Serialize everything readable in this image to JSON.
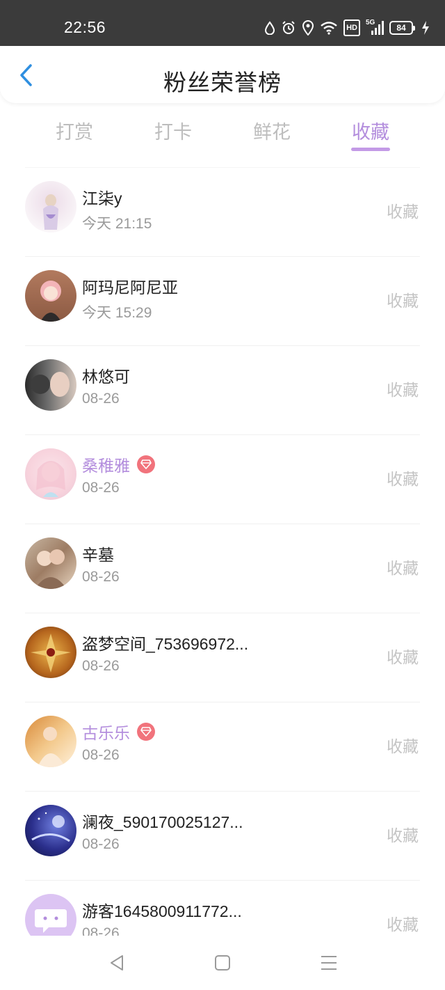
{
  "status_bar": {
    "time": "22:56",
    "network": "5G",
    "hd": "HD",
    "battery": "84",
    "icons": [
      "drop-icon",
      "alarm-icon",
      "location-icon",
      "wifi-icon",
      "hd-icon",
      "signal-icon",
      "battery-icon",
      "charging-icon"
    ]
  },
  "header": {
    "title": "粉丝荣誉榜",
    "back_icon": "chevron-left-icon"
  },
  "tabs": [
    {
      "label": "打赏",
      "active": false
    },
    {
      "label": "打卡",
      "active": false
    },
    {
      "label": "鲜花",
      "active": false
    },
    {
      "label": "收藏",
      "active": true
    }
  ],
  "colors": {
    "accent": "#b38ddd",
    "vip_badge": "#f1737c",
    "status_bar": "#3b3b3b",
    "muted_text": "#9a9a9a",
    "action_text": "#c4c4c4"
  },
  "fans": [
    {
      "name": "江柒y",
      "time": "今天 21:15",
      "action": "收藏",
      "vip": false
    },
    {
      "name": "阿玛尼阿尼亚",
      "time": "今天 15:29",
      "action": "收藏",
      "vip": false
    },
    {
      "name": "林悠可",
      "time": "08-26",
      "action": "收藏",
      "vip": false
    },
    {
      "name": "桑稚雅",
      "time": "08-26",
      "action": "收藏",
      "vip": true
    },
    {
      "name": "辛墓",
      "time": "08-26",
      "action": "收藏",
      "vip": false
    },
    {
      "name": "盗梦空间_753696972...",
      "time": "08-26",
      "action": "收藏",
      "vip": false
    },
    {
      "name": "古乐乐",
      "time": "08-26",
      "action": "收藏",
      "vip": true
    },
    {
      "name": "澜夜_590170025127...",
      "time": "08-26",
      "action": "收藏",
      "vip": false
    },
    {
      "name": "游客1645800911772...",
      "time": "08-26",
      "action": "收藏",
      "vip": false
    }
  ],
  "nav_bar": {
    "icons": [
      "back-triangle-icon",
      "home-square-icon",
      "menu-lines-icon"
    ]
  }
}
